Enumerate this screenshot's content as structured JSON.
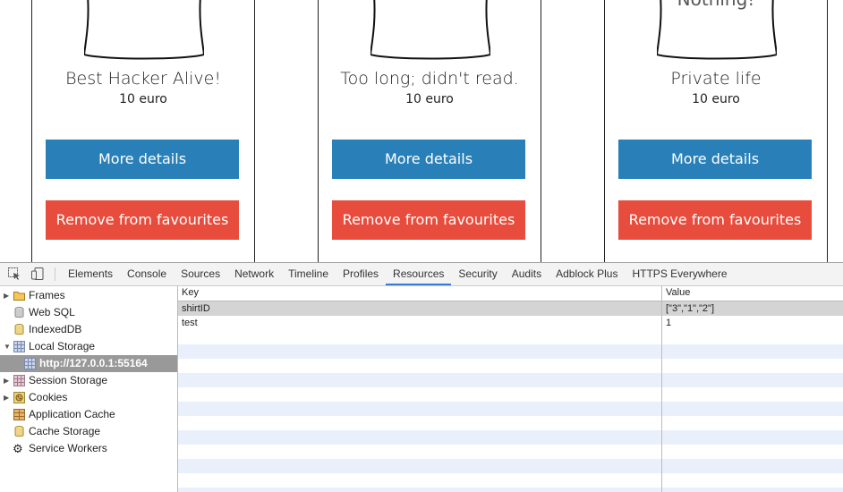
{
  "cards": [
    {
      "shirt_text": "",
      "title": "Best Hacker Alive!",
      "price": "10 euro",
      "details_label": "More details",
      "remove_label": "Remove from favourites"
    },
    {
      "shirt_text": "",
      "title": "Too long; didn't read.",
      "price": "10 euro",
      "details_label": "More details",
      "remove_label": "Remove from favourites"
    },
    {
      "shirt_text": "Nothing!",
      "title": "Private life",
      "price": "10 euro",
      "details_label": "More details",
      "remove_label": "Remove from favourites"
    }
  ],
  "colors": {
    "blue_button": "#2980b9",
    "red_button": "#e74c3c",
    "active_tab": "#3879d9"
  },
  "devtools": {
    "tabs": [
      "Elements",
      "Console",
      "Sources",
      "Network",
      "Timeline",
      "Profiles",
      "Resources",
      "Security",
      "Audits",
      "Adblock Plus",
      "HTTPS Everywhere"
    ],
    "active_tab": "Resources",
    "sidebar": [
      {
        "label": "Frames",
        "icon": "folder-icon",
        "expanded": false
      },
      {
        "label": "Web SQL",
        "icon": "database-icon"
      },
      {
        "label": "IndexedDB",
        "icon": "database-icon"
      },
      {
        "label": "Local Storage",
        "icon": "storage-grid-icon",
        "expanded": true
      },
      {
        "label": "http://127.0.0.1:55164",
        "icon": "storage-grid-icon",
        "selected": true
      },
      {
        "label": "Session Storage",
        "icon": "storage-grid-icon",
        "expanded": false
      },
      {
        "label": "Cookies",
        "icon": "cookie-icon",
        "expanded": false
      },
      {
        "label": "Application Cache",
        "icon": "grid-icon"
      },
      {
        "label": "Cache Storage",
        "icon": "database-icon"
      },
      {
        "label": "Service Workers",
        "icon": "gear-icon"
      }
    ],
    "grid": {
      "headers": {
        "key": "Key",
        "value": "Value"
      },
      "rows": [
        {
          "key": "shirtID",
          "value": "[\"3\",\"1\",\"2\"]"
        },
        {
          "key": "test",
          "value": "1"
        }
      ]
    }
  }
}
